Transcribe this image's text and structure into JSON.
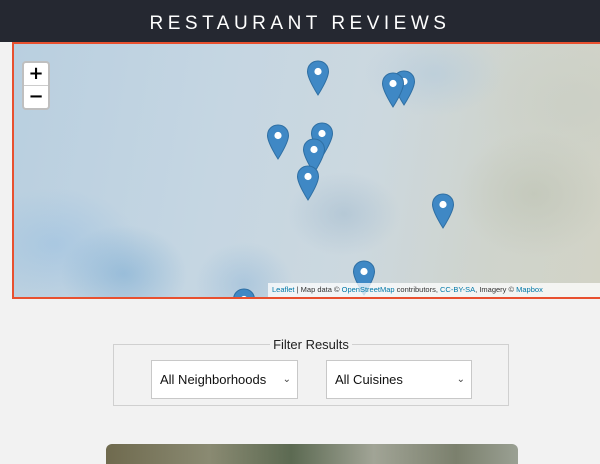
{
  "header": {
    "title": "RESTAURANT REVIEWS"
  },
  "map": {
    "zoom_in_label": "+",
    "zoom_out_label": "−",
    "marker_color": "#3f88c5",
    "attribution": {
      "leaflet": "Leaflet",
      "sep1": " | Map data © ",
      "osm": "OpenStreetMap",
      "sep2": " contributors, ",
      "license": "CC-BY-SA",
      "sep3": ", Imagery © ",
      "imagery": "Mapbox"
    }
  },
  "filter": {
    "legend": "Filter Results",
    "neighborhoods_selected": "All Neighborhoods",
    "cuisines_selected": "All Cuisines"
  },
  "accent_color": "#e8502f"
}
